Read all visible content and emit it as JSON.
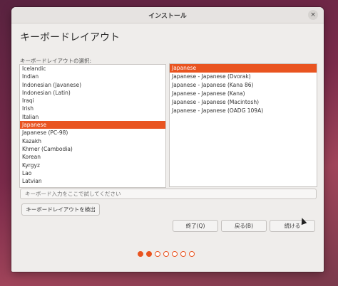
{
  "window": {
    "title": "インストール",
    "close_icon": "×"
  },
  "page": {
    "heading": "キーボードレイアウト",
    "list_label": "キーボードレイアウトの選択:"
  },
  "layouts": [
    {
      "label": "Icelandic",
      "selected": false
    },
    {
      "label": "Indian",
      "selected": false
    },
    {
      "label": "Indonesian (Javanese)",
      "selected": false
    },
    {
      "label": "Indonesian (Latin)",
      "selected": false
    },
    {
      "label": "Iraqi",
      "selected": false
    },
    {
      "label": "Irish",
      "selected": false
    },
    {
      "label": "Italian",
      "selected": false
    },
    {
      "label": "Japanese",
      "selected": true
    },
    {
      "label": "Japanese (PC-98)",
      "selected": false
    },
    {
      "label": "Kazakh",
      "selected": false
    },
    {
      "label": "Khmer (Cambodia)",
      "selected": false
    },
    {
      "label": "Korean",
      "selected": false
    },
    {
      "label": "Kyrgyz",
      "selected": false
    },
    {
      "label": "Lao",
      "selected": false
    },
    {
      "label": "Latvian",
      "selected": false
    }
  ],
  "variants": [
    {
      "label": "Japanese",
      "selected": true
    },
    {
      "label": "Japanese - Japanese (Dvorak)",
      "selected": false
    },
    {
      "label": "Japanese - Japanese (Kana 86)",
      "selected": false
    },
    {
      "label": "Japanese - Japanese (Kana)",
      "selected": false
    },
    {
      "label": "Japanese - Japanese (Macintosh)",
      "selected": false
    },
    {
      "label": "Japanese - Japanese (OADG 109A)",
      "selected": false
    }
  ],
  "test_field": {
    "placeholder": "キーボード入力をここで試してください",
    "value": ""
  },
  "buttons": {
    "detect": "キーボードレイアウトを検出",
    "quit": "終了(Q)",
    "back": "戻る(B)",
    "continue": "続ける"
  },
  "progress": {
    "total_steps": 7,
    "completed_steps": 2
  },
  "colors": {
    "accent": "#e95420"
  }
}
